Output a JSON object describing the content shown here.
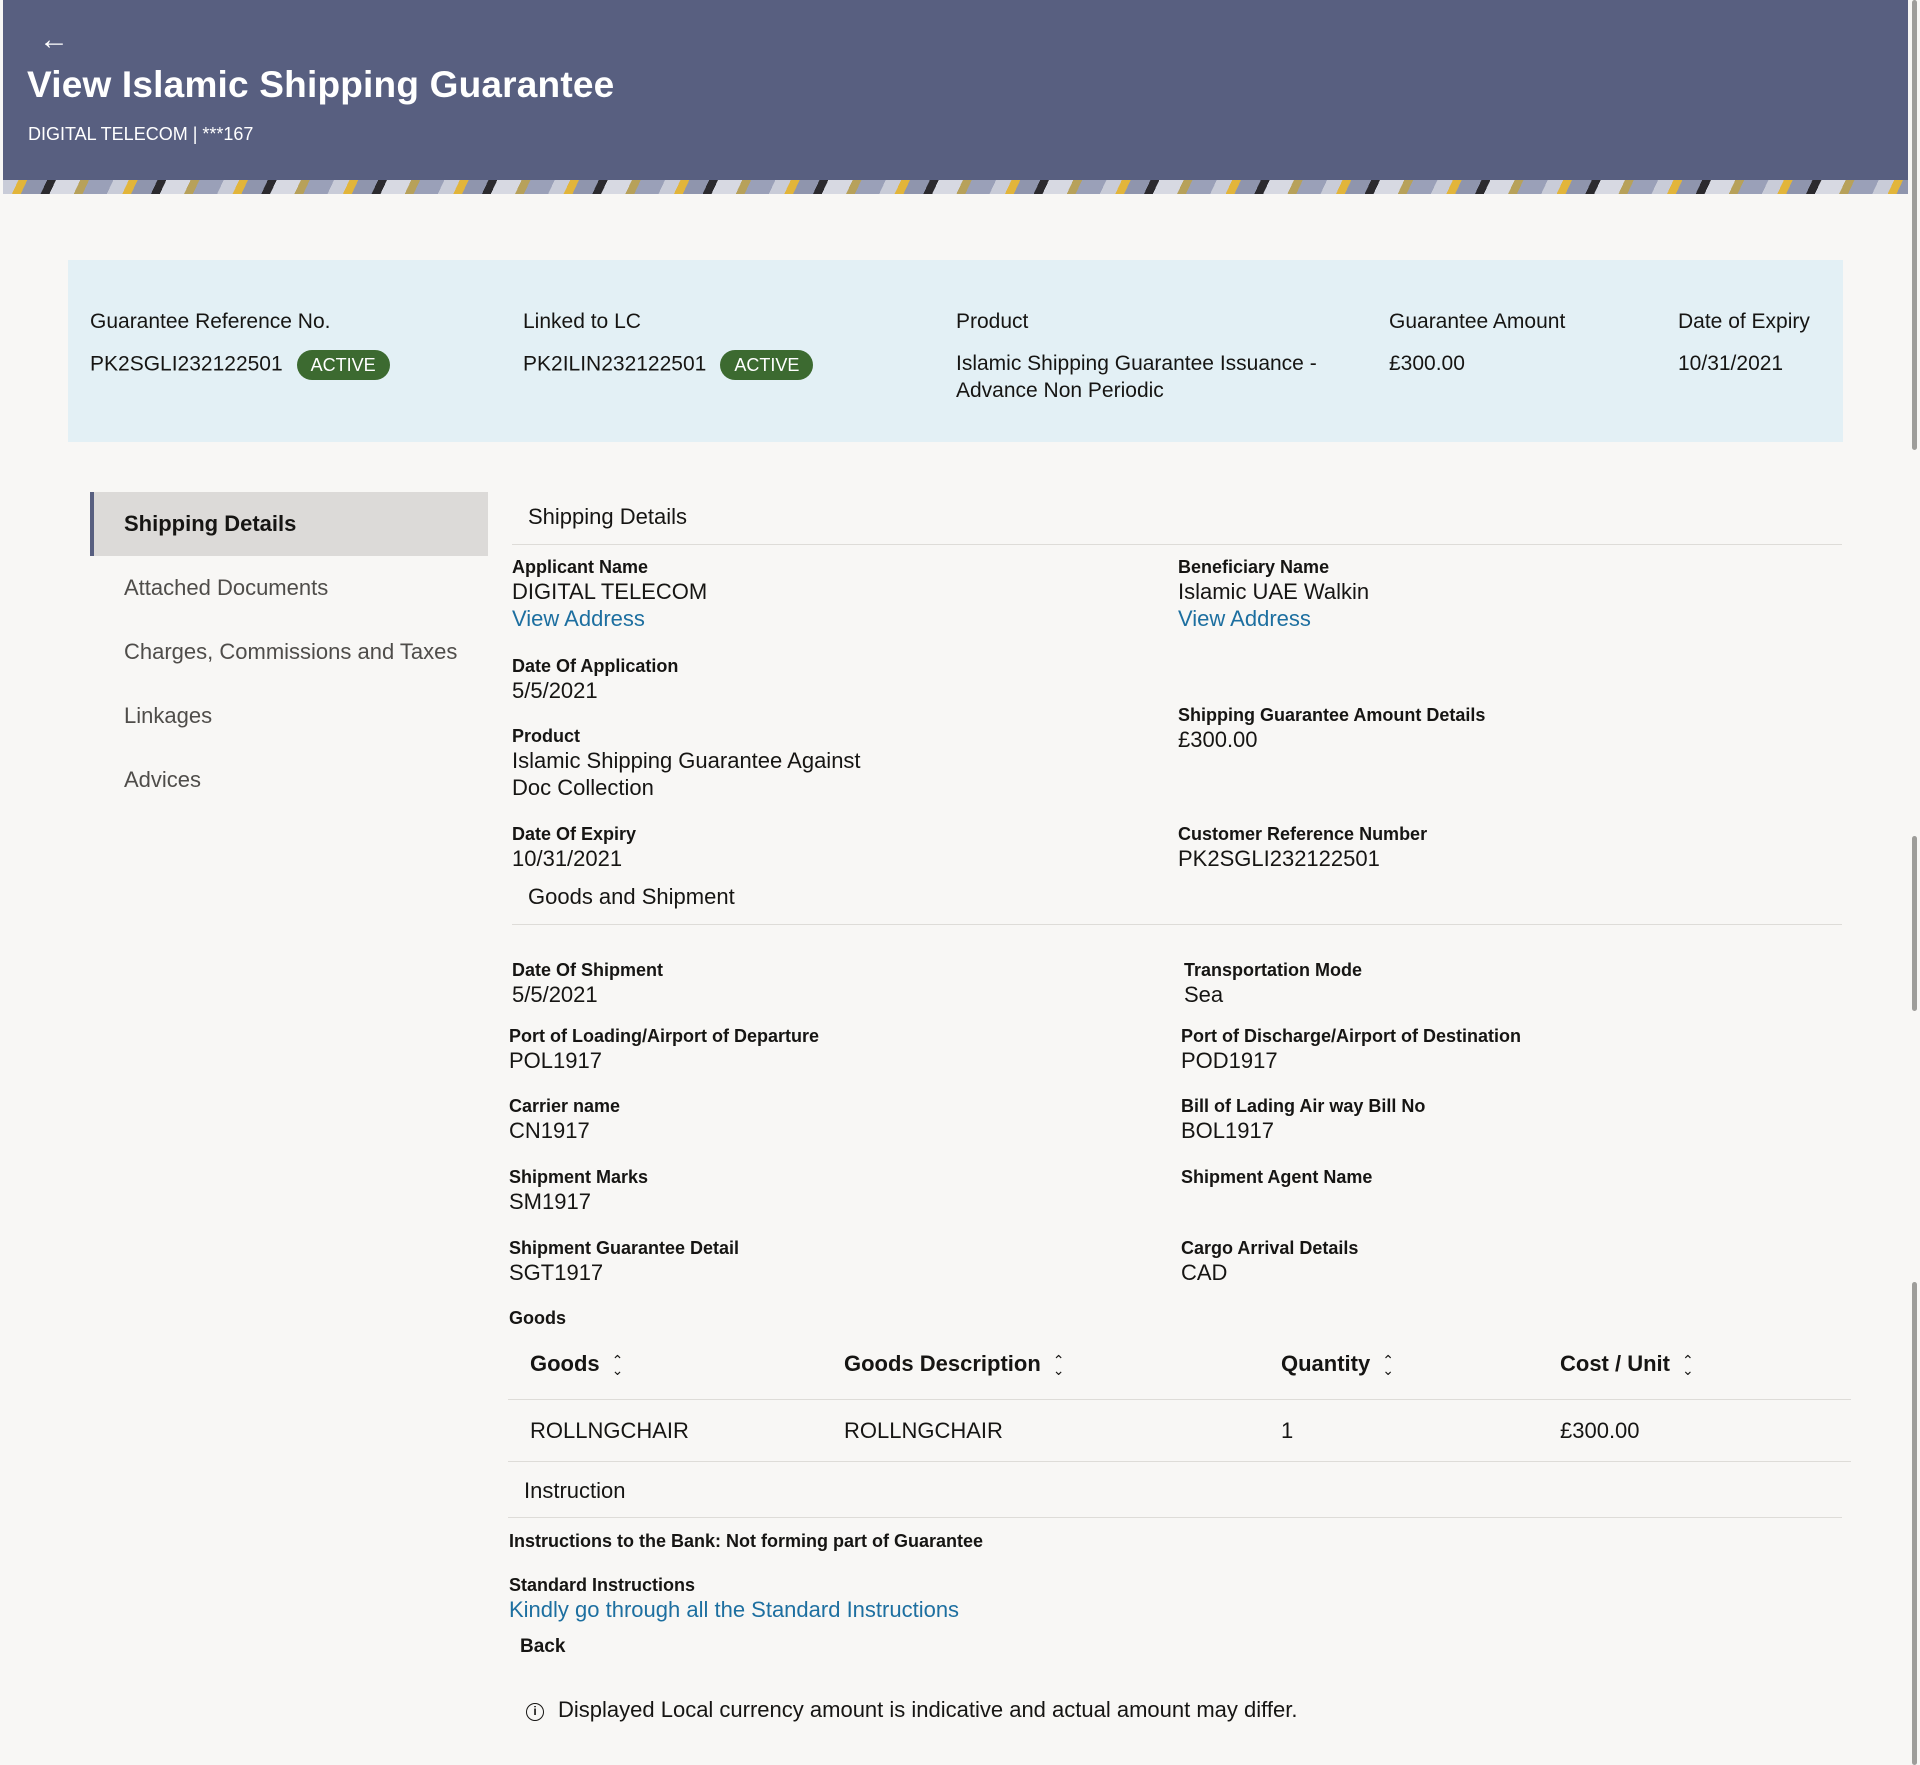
{
  "header": {
    "back_glyph": "←",
    "title": "View Islamic Shipping Guarantee",
    "subtitle": "DIGITAL TELECOM | ***167",
    "bg_color": "#585f80"
  },
  "summary": {
    "guarantee_ref": {
      "label": "Guarantee Reference No.",
      "value": "PK2SGLI232122501",
      "status": "ACTIVE"
    },
    "linked_lc": {
      "label": "Linked to LC",
      "value": "PK2ILIN232122501",
      "status": "ACTIVE"
    },
    "product": {
      "label": "Product",
      "value_line1": "Islamic Shipping Guarantee Issuance -",
      "value_line2": "Advance Non Periodic"
    },
    "amount": {
      "label": "Guarantee Amount",
      "value": "£300.00"
    },
    "expiry": {
      "label": "Date of Expiry",
      "value": "10/31/2021"
    },
    "status_color": "#3c6a30"
  },
  "sidenav": {
    "items": [
      {
        "label": "Shipping Details",
        "active": true
      },
      {
        "label": "Attached Documents"
      },
      {
        "label": "Charges, Commissions and Taxes"
      },
      {
        "label": "Linkages"
      },
      {
        "label": "Advices"
      }
    ]
  },
  "shipping": {
    "section_title": "Shipping Details",
    "applicant": {
      "label": "Applicant Name",
      "value": "DIGITAL TELECOM",
      "link": "View Address"
    },
    "beneficiary": {
      "label": "Beneficiary Name",
      "value": "Islamic UAE Walkin",
      "link": "View Address"
    },
    "date_of_application": {
      "label": "Date Of Application",
      "value": "5/5/2021"
    },
    "amount_details": {
      "label": "Shipping Guarantee Amount Details",
      "value": "£300.00"
    },
    "product": {
      "label": "Product",
      "value_line1": "Islamic Shipping Guarantee Against",
      "value_line2": "Doc Collection"
    },
    "date_of_expiry": {
      "label": "Date Of Expiry",
      "value": "10/31/2021"
    },
    "customer_ref": {
      "label": "Customer Reference Number",
      "value": "PK2SGLI232122501"
    }
  },
  "goods_shipment": {
    "section_title": "Goods and Shipment",
    "date_of_shipment": {
      "label": "Date Of Shipment",
      "value": "5/5/2021"
    },
    "transport_mode": {
      "label": "Transportation Mode",
      "value": "Sea"
    },
    "port_loading": {
      "label": "Port of Loading/Airport of Departure",
      "value": "POL1917"
    },
    "port_discharge": {
      "label": "Port of Discharge/Airport of Destination",
      "value": "POD1917"
    },
    "carrier": {
      "label": "Carrier name",
      "value": "CN1917"
    },
    "bill_of_lading": {
      "label": "Bill of Lading Air way Bill No",
      "value": "BOL1917"
    },
    "shipment_marks": {
      "label": "Shipment Marks",
      "value": "SM1917"
    },
    "agent_name": {
      "label": "Shipment Agent Name",
      "value": ""
    },
    "guarantee_detail": {
      "label": "Shipment Guarantee Detail",
      "value": "SGT1917"
    },
    "cargo_arrival": {
      "label": "Cargo Arrival Details",
      "value": "CAD"
    },
    "goods_label": "Goods",
    "table": {
      "columns": [
        "Goods",
        "Goods Description",
        "Quantity",
        "Cost / Unit"
      ],
      "rows": [
        [
          "ROLLNGCHAIR",
          "ROLLNGCHAIR",
          "1",
          "£300.00"
        ]
      ]
    }
  },
  "instruction": {
    "section_title": "Instruction",
    "bank_instructions": "Instructions to the Bank: Not forming part of Guarantee",
    "standard": {
      "label": "Standard Instructions",
      "link": "Kindly go through all the Standard Instructions"
    }
  },
  "footer": {
    "back_label": "Back",
    "disclaimer": "Displayed Local currency amount is indicative and actual amount may differ."
  }
}
